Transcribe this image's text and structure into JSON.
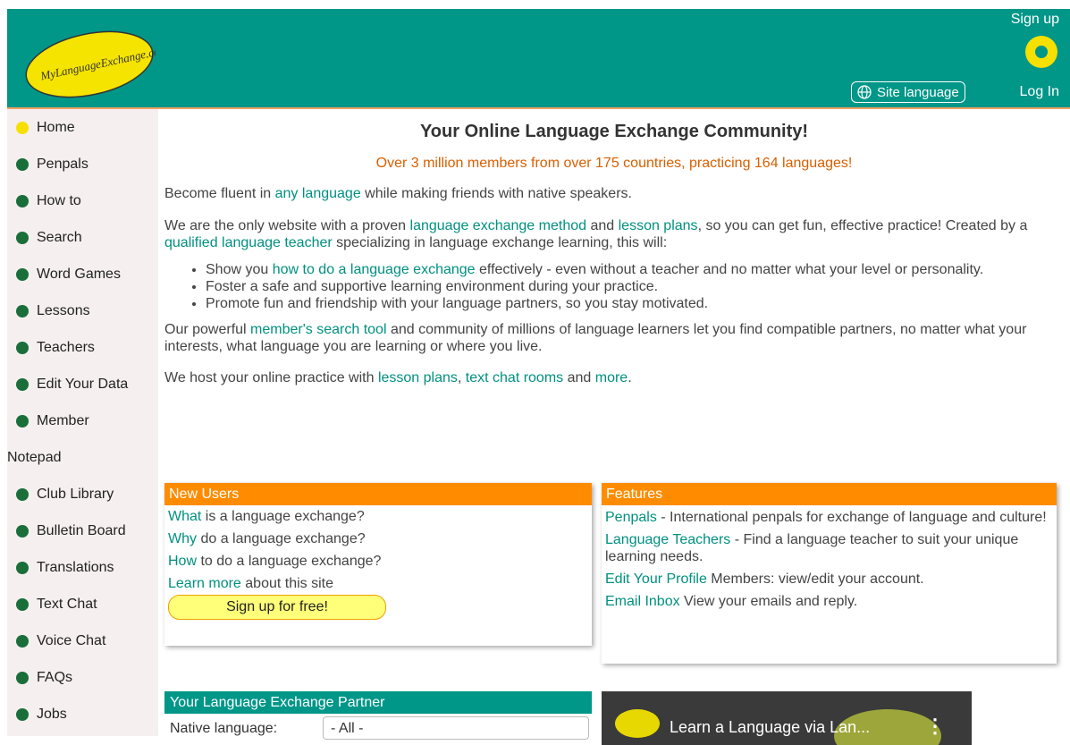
{
  "header": {
    "logo_text": "MyLanguageExchange.com",
    "signup": "Sign up",
    "login": "Log In",
    "site_language": "Site language"
  },
  "sidebar": {
    "items": [
      {
        "label": "Home",
        "active": true
      },
      {
        "label": "Penpals"
      },
      {
        "label": "How to"
      },
      {
        "label": "Search"
      },
      {
        "label": "Word Games"
      },
      {
        "label": "Lessons"
      },
      {
        "label": "Teachers"
      },
      {
        "label": "Edit Your Data"
      },
      {
        "label": "Member"
      }
    ],
    "notepad": "Notepad",
    "items2": [
      {
        "label": "Club Library"
      },
      {
        "label": "Bulletin Board"
      },
      {
        "label": "Translations"
      },
      {
        "label": "Text Chat"
      },
      {
        "label": "Voice Chat"
      },
      {
        "label": "FAQs"
      },
      {
        "label": "Jobs"
      }
    ]
  },
  "main": {
    "title": "Your Online Language Exchange Community!",
    "subtitle": "Over 3 million members from over 175 countries, practicing 164 languages!",
    "p1": {
      "a": "Become fluent in ",
      "link": "any language",
      "b": " while making friends with native speakers."
    },
    "p2": {
      "a": "We are the only website with a proven ",
      "link1": "language exchange method",
      "b": " and ",
      "link2": "lesson plans",
      "c": ", so you can get fun, effective practice! Created by a ",
      "link3": "qualified language teacher",
      "d": " specializing in language exchange learning, this will:"
    },
    "bullets": {
      "b1a": "Show you ",
      "b1link": "how to do a language exchange",
      "b1b": " effectively - even without a teacher and no matter what your level or personality.",
      "b2": "Foster a safe and supportive learning environment during your practice.",
      "b3": "Promote fun and friendship with your language partners, so you stay motivated."
    },
    "p3": {
      "a": "Our powerful ",
      "link": "member's search tool",
      "b": " and community of millions of language learners let you find compatible partners, no matter what your interests, what language you are learning or where you live."
    },
    "p4": {
      "a": "We host your online practice with ",
      "link1": "lesson plans",
      "b": ", ",
      "link2": "text chat rooms",
      "c": " and ",
      "link3": "more",
      "d": "."
    }
  },
  "new_users": {
    "title": "New Users",
    "rows": [
      {
        "link": "What",
        "text": " is a language exchange?"
      },
      {
        "link": "Why",
        "text": " do a language exchange?"
      },
      {
        "link": "How",
        "text": " to do a language exchange?"
      },
      {
        "link": "Learn more",
        "text": " about this site"
      }
    ],
    "signup_button": "Sign up for free!"
  },
  "features": {
    "title": "Features",
    "rows": [
      {
        "link": "Penpals",
        "text": " - International penpals for exchange of language and culture!"
      },
      {
        "link": "Language Teachers",
        "text": " - Find a language teacher to suit your unique learning needs."
      },
      {
        "link": "Edit Your Profile",
        "text": " Members: view/edit your account."
      },
      {
        "link": "Email Inbox",
        "text": " View your emails and reply."
      }
    ]
  },
  "partner": {
    "title": "Your Language Exchange Partner",
    "native_label": "Native language:",
    "native_value": "- All -"
  },
  "video": {
    "title": "Learn a Language via Lan..."
  },
  "colors": {
    "header_bg": "#009688",
    "accent_orange": "#ff8c00",
    "link": "#009080",
    "subtitle": "#d95f00"
  }
}
